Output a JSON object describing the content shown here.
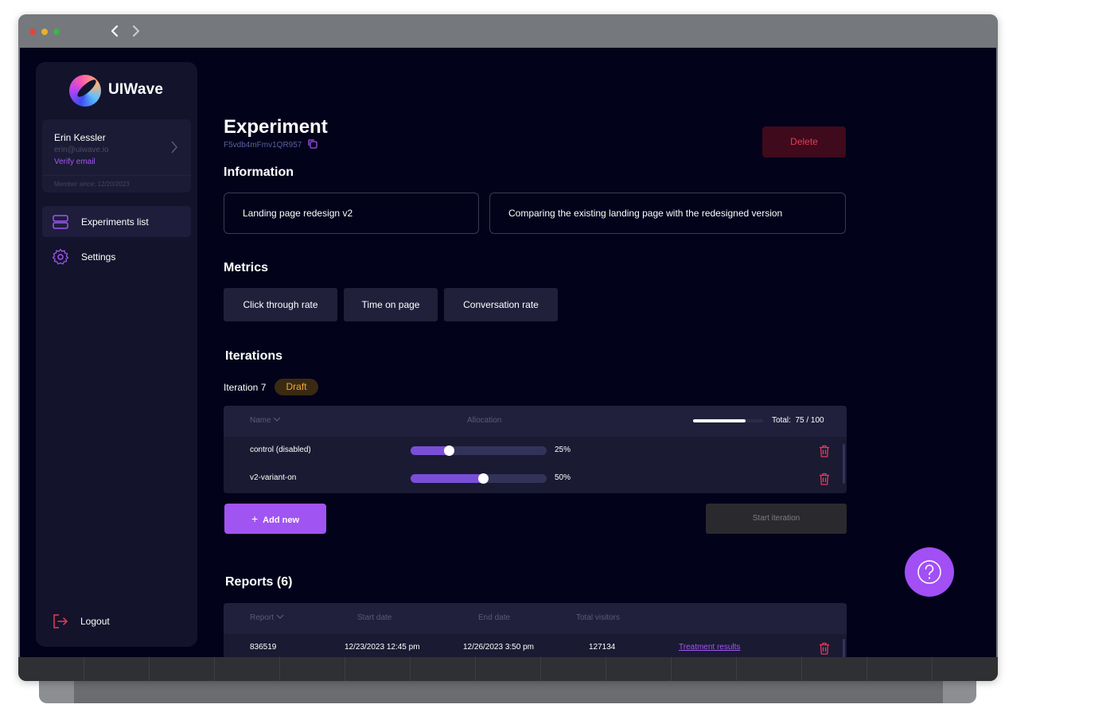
{
  "brand": {
    "name": "UIWave"
  },
  "profile": {
    "name": "Erin Kessler",
    "email": "erin@uiwave.io",
    "verify_label": "Verify email",
    "member_since": "Member since: 12/20/2023"
  },
  "nav": {
    "experiments_label": "Experiments list",
    "settings_label": "Settings",
    "logout_label": "Logout"
  },
  "experiment": {
    "title": "Experiment",
    "id": "F5vdb4mFmv1QR957",
    "delete_label": "Delete"
  },
  "information": {
    "heading": "Information",
    "name": "Landing page redesign v2",
    "description": "Comparing the existing landing page with the redesigned version"
  },
  "metrics": {
    "heading": "Metrics",
    "items": [
      "Click through rate",
      "Time on page",
      "Conversation rate"
    ]
  },
  "iterations": {
    "heading": "Iterations",
    "iteration_label": "Iteration 7",
    "status": "Draft",
    "columns": {
      "name": "Name",
      "allocation": "Allocation"
    },
    "total_label": "Total:",
    "total_value": "75 / 100",
    "total_fraction": 0.75,
    "rows": [
      {
        "name": "control (disabled)",
        "allocation": "25%",
        "fraction": 0.25
      },
      {
        "name": "v2-variant-on",
        "allocation": "50%",
        "fraction": 0.5
      }
    ],
    "add_label": "Add new",
    "start_label": "Start iteration"
  },
  "reports": {
    "heading": "Reports (6)",
    "columns": [
      "Report",
      "Start date",
      "End date",
      "Total visitors"
    ],
    "rows": [
      {
        "report": "836519",
        "start": "12/23/2023 12:45 pm",
        "end": "12/26/2023 3:50 pm",
        "visitors": "127134",
        "link": "Treatment results"
      }
    ]
  },
  "colors": {
    "accent": "#a055f2",
    "background": "#02021a",
    "danger": "#ea3b55",
    "draft": "#f0a63a"
  }
}
